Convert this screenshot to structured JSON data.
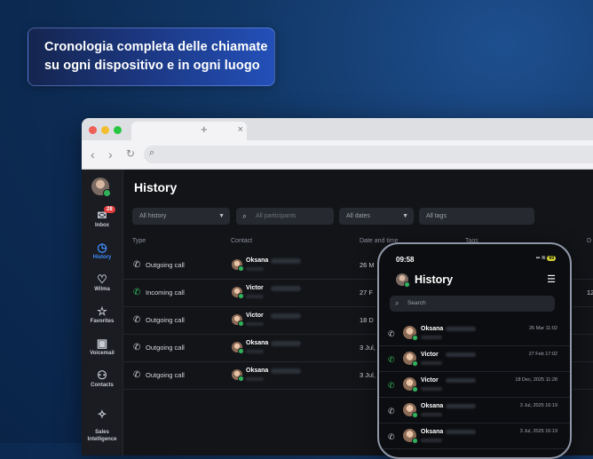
{
  "headline": {
    "line1": "Cronologia completa delle chiamate",
    "line2": "su ogni dispositivo e in ogni luogo"
  },
  "browser": {
    "tab_close": "×",
    "new_tab": "+",
    "back": "‹",
    "forward": "›",
    "reload": "↻"
  },
  "sidebar": {
    "items": [
      {
        "label": "Inbox",
        "icon": "inbox-icon",
        "glyph": "✉",
        "badge": "28"
      },
      {
        "label": "History",
        "icon": "clock-icon",
        "glyph": "◷",
        "active": true
      },
      {
        "label": "Wilma",
        "icon": "heart-icon",
        "glyph": "♡"
      },
      {
        "label": "Favorites",
        "icon": "star-icon",
        "glyph": "☆"
      },
      {
        "label": "Voicemail",
        "icon": "voicemail-icon",
        "glyph": "▣"
      },
      {
        "label": "Contacts",
        "icon": "contacts-icon",
        "glyph": "⚇"
      },
      {
        "label": "Sales\nIntelligence",
        "icon": "sparkle-icon",
        "glyph": "✧"
      }
    ]
  },
  "main": {
    "title": "History",
    "filters": {
      "history": "All history",
      "participants_placeholder": "All participants",
      "dates": "All dates",
      "tags": "All tags"
    },
    "columns": {
      "type": "Type",
      "contact": "Contact",
      "date_time": "Date and time",
      "tags": "Tags",
      "d": "D"
    },
    "rows": [
      {
        "type": "Outgoing call",
        "direction": "out",
        "contact": "Oksana",
        "date": "26 M",
        "num": ""
      },
      {
        "type": "Incoming call",
        "direction": "in",
        "contact": "Victor",
        "date": "27 F",
        "num": "12"
      },
      {
        "type": "Outgoing call",
        "direction": "out",
        "contact": "Victor",
        "date": "18 D",
        "num": ""
      },
      {
        "type": "Outgoing call",
        "direction": "out",
        "contact": "Oksana",
        "date": "3 Jul,",
        "num": ""
      },
      {
        "type": "Outgoing call",
        "direction": "out",
        "contact": "Oksana",
        "date": "3 Jul, 20",
        "num": ""
      }
    ]
  },
  "phone": {
    "time": "09:58",
    "battery": "69",
    "title": "History",
    "search_placeholder": "Search",
    "rows": [
      {
        "contact": "Oksana",
        "date": "26 Mar 11:02",
        "direction": "out"
      },
      {
        "contact": "Victor",
        "date": "27 Feb 17:02",
        "direction": "in"
      },
      {
        "contact": "Victor",
        "date": "18 Dec, 2025 11:28",
        "direction": "out"
      },
      {
        "contact": "Oksana",
        "date": "3 Jul, 2025 16:19",
        "direction": "out"
      },
      {
        "contact": "Oksana",
        "date": "3 Jul, 2025 16:19",
        "direction": "out"
      }
    ]
  },
  "colors": {
    "accent": "#3f8cff",
    "online": "#2fb35a",
    "badge": "#e23c3c",
    "incoming": "#36b85e"
  }
}
